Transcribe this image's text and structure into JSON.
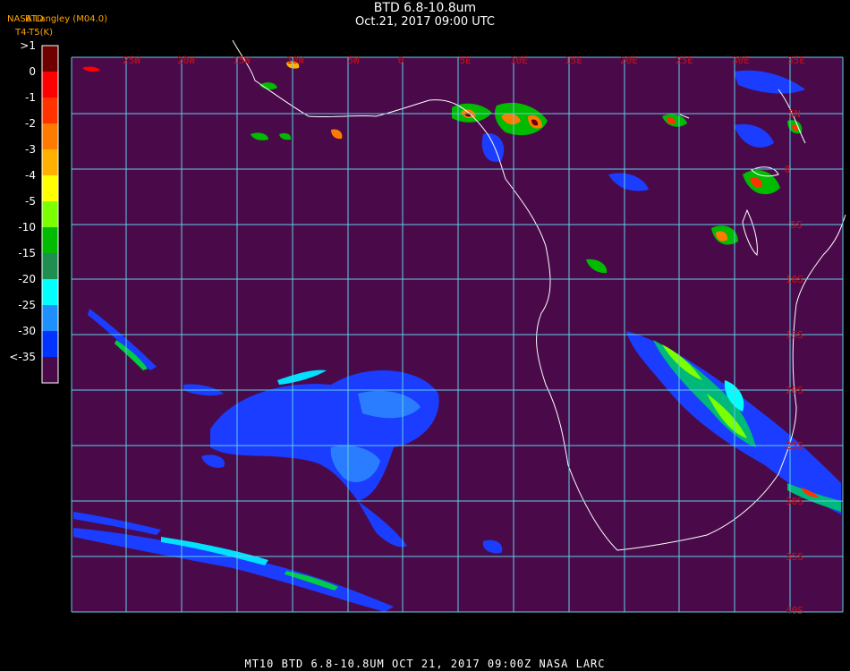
{
  "header": {
    "title": "BTD 6.8-10.8um",
    "subtitle": "Oct.21, 2017 09:00 UTC",
    "credit": "NASA Langley (M04.0)",
    "band_label_top": "BTD",
    "band_label_bottom": "T4-T5(K)"
  },
  "legend": {
    "labels": [
      ">1",
      "0",
      "-1",
      "-2",
      "-3",
      "-4",
      "-5",
      "-10",
      "-15",
      "-20",
      "-25",
      "-30",
      "<-35"
    ],
    "colors": [
      "#6e0000",
      "#ff0000",
      "#ff3300",
      "#ff7a00",
      "#ffb000",
      "#ffff00",
      "#7cff00",
      "#00bb00",
      "#1e8f50",
      "#00ffff",
      "#1e8fff",
      "#0033ff",
      "#4a0a4a"
    ]
  },
  "map": {
    "background": "#4a0a4a",
    "grid_color": "#5fd0e6",
    "label_color": "#cc1111",
    "lon_labels": [
      "25W",
      "20W",
      "15W",
      "10W",
      "5W",
      "0",
      "5E",
      "10E",
      "15E",
      "20E",
      "25E",
      "30E",
      "35E"
    ],
    "lat_labels": [
      "5N",
      "0",
      "5S",
      "10S",
      "15S",
      "20S",
      "25S",
      "30S",
      "35S",
      "40S"
    ]
  },
  "footer": {
    "text": "MT10  BTD 6.8-10.8UM   OCT 21, 2017 09:00Z   NASA LARC"
  }
}
